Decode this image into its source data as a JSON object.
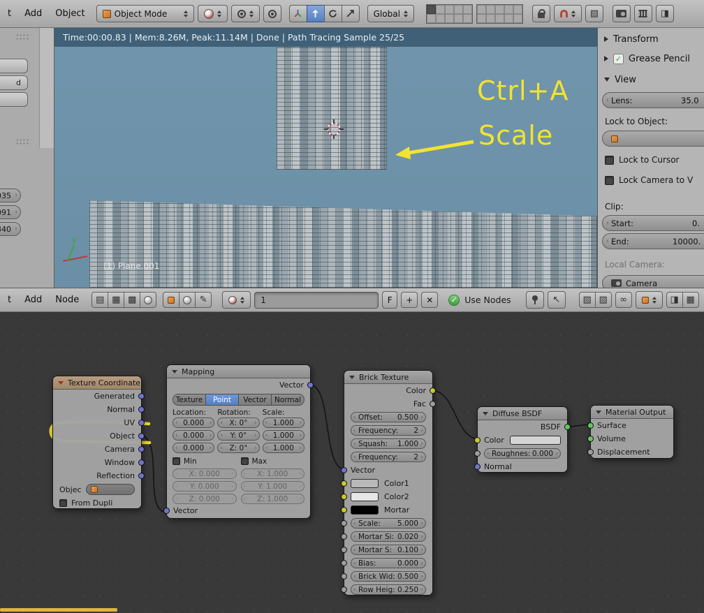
{
  "colors": {
    "accent_blue": "#5680c2",
    "annotation_yellow": "#f2e330",
    "viewport_blue": "#6e93aa",
    "stats_bar_bg": "#3f6077",
    "node_editor_bg": "#3a3a3a",
    "socket_vector": "#7272cf",
    "socket_color": "#c7c732",
    "socket_shader": "#63c763",
    "socket_value": "#9d9d9d",
    "swatch_color1": "#b9b9b9",
    "swatch_color2": "#e6e6e6",
    "swatch_mortar": "#000000"
  },
  "icons": {
    "editor_grid": "▤",
    "editor_image": "▦",
    "editor_checker": "▩",
    "editor_sphere": "●",
    "pencil": "✎",
    "up_arrow": "↖",
    "link": "∞",
    "box_a": "▧",
    "box_b": "▨",
    "box_c": "◨"
  },
  "top_header": {
    "menu_fragment": "t",
    "menu_add": "Add",
    "menu_object": "Object",
    "mode": "Object Mode",
    "orientation": "Global"
  },
  "viewport": {
    "stats": "Time:00:00.83 | Mem:8.26M, Peak:11.14M | Done | Path Tracing Sample 25/25",
    "object_label": "(1) Plane.001",
    "axis_y_label": "y",
    "annotation_line1": "Ctrl+A",
    "annotation_line2": "Scale"
  },
  "tool_shelf": {
    "button_fragment": "d",
    "slider_fragments": [
      "035",
      "091",
      "340"
    ]
  },
  "n_panel": {
    "transform_label": "Transform",
    "grease_pencil_label": "Grease Pencil",
    "view_label": "View",
    "lens_label": "Lens:",
    "lens_value": "35.0",
    "lock_to_object_label": "Lock to Object:",
    "lock_to_cursor_label": "Lock to Cursor",
    "lock_camera_label": "Lock Camera to V",
    "clip_label": "Clip:",
    "clip_start_label": "Start:",
    "clip_start_value": "0.",
    "clip_end_label": "End:",
    "clip_end_value": "10000.",
    "local_camera_label": "Local Camera:",
    "camera_field_value": "Camera"
  },
  "node_header": {
    "menu_fragment": "t",
    "menu_add": "Add",
    "menu_node": "Node",
    "name_value": "1",
    "fake_user_label": "F",
    "plus_label": "+",
    "close_label": "✕",
    "use_nodes_label": "Use Nodes"
  },
  "nodes": {
    "texture_coordinate": {
      "title": "Texture Coordinate",
      "outputs": [
        "Generated",
        "Normal",
        "UV",
        "Object",
        "Camera",
        "Window",
        "Reflection"
      ],
      "object_label": "Objec",
      "from_dupli_label": "From Dupli"
    },
    "mapping": {
      "title": "Mapping",
      "output_label": "Vector",
      "modes": [
        "Texture",
        "Point",
        "Vector",
        "Normal"
      ],
      "active_mode": "Point",
      "location_label": "Location:",
      "rotation_label": "Rotation:",
      "scale_label": "Scale:",
      "location": [
        "0.000",
        "0.000",
        "0.000"
      ],
      "rotation": [
        "X: 0°",
        "Y: 0°",
        "Z: 0°"
      ],
      "scale": [
        "1.000",
        "1.000",
        "1.000"
      ],
      "min_label": "Min",
      "max_label": "Max",
      "min_values": [
        "X: 0.000",
        "Y: 0.000",
        "Z: 0.000"
      ],
      "max_values": [
        "X: 1.000",
        "Y: 1.000",
        "Z: 1.000"
      ],
      "input_label": "Vector"
    },
    "brick_texture": {
      "title": "Brick Texture",
      "output_color": "Color",
      "output_fac": "Fac",
      "params": [
        {
          "label": "Offset:",
          "value": "0.500"
        },
        {
          "label": "Frequency:",
          "value": "2"
        },
        {
          "label": "Squash:",
          "value": "1.000"
        },
        {
          "label": "Frequency:",
          "value": "2"
        }
      ],
      "input_vector": "Vector",
      "input_color1": "Color1",
      "input_color2": "Color2",
      "input_mortar": "Mortar",
      "sliders": [
        {
          "label": "Scale:",
          "value": "5.000"
        },
        {
          "label": "Mortar Si:",
          "value": "0.020"
        },
        {
          "label": "Mortar S:",
          "value": "0.100"
        },
        {
          "label": "Bias:",
          "value": "0.000"
        },
        {
          "label": "Brick Wid:",
          "value": "0.500"
        },
        {
          "label": "Row Heig:",
          "value": "0.250"
        }
      ]
    },
    "diffuse_bsdf": {
      "title": "Diffuse BSDF",
      "output_label": "BSDF",
      "input_color": "Color",
      "roughness_label": "Roughnes:",
      "roughness_value": "0.000",
      "input_normal": "Normal"
    },
    "material_output": {
      "title": "Material Output",
      "inputs": [
        "Surface",
        "Volume",
        "Displacement"
      ]
    }
  }
}
